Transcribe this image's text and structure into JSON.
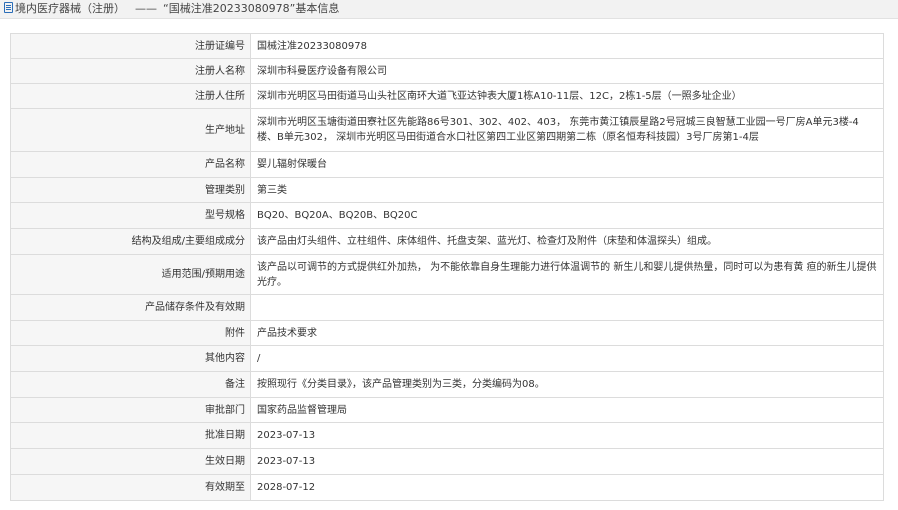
{
  "header": {
    "category": "境内医疗器械（注册）",
    "separator": "——",
    "title": "“国械注准20233080978”基本信息"
  },
  "rows": [
    {
      "label": "注册证编号",
      "value": "国械注准20233080978"
    },
    {
      "label": "注册人名称",
      "value": "深圳市科曼医疗设备有限公司"
    },
    {
      "label": "注册人住所",
      "value": "深圳市光明区马田街道马山头社区南环大道飞亚达钟表大厦1栋A10-11层、12C，2栋1-5层（一照多址企业）"
    },
    {
      "label": "生产地址",
      "value": "深圳市光明区玉塘街道田寮社区先能路86号301、302、402、403， 东莞市黄江镇辰星路2号冠城三良智慧工业园一号厂房A单元3楼-4楼、B单元302， 深圳市光明区马田街道合水口社区第四工业区第四期第二栋（原名恒寿科技园）3号厂房第1-4层"
    },
    {
      "label": "产品名称",
      "value": "婴儿辐射保暖台"
    },
    {
      "label": "管理类别",
      "value": "第三类"
    },
    {
      "label": "型号规格",
      "value": "BQ20、BQ20A、BQ20B、BQ20C"
    },
    {
      "label": "结构及组成/主要组成成分",
      "value": "该产品由灯头组件、立柱组件、床体组件、托盘支架、蓝光灯、检查灯及附件（床垫和体温探头）组成。"
    },
    {
      "label": "适用范围/预期用途",
      "value": "该产品以可调节的方式提供红外加热， 为不能依靠自身生理能力进行体温调节的 新生儿和婴儿提供热量，同时可以为患有黄 疸的新生儿提供光疗。"
    },
    {
      "label": "产品储存条件及有效期",
      "value": ""
    },
    {
      "label": "附件",
      "value": "产品技术要求"
    },
    {
      "label": "其他内容",
      "value": "/"
    },
    {
      "label": "备注",
      "value": "按照现行《分类目录》，该产品管理类别为三类，分类编码为08。"
    },
    {
      "label": "审批部门",
      "value": "国家药品监督管理局"
    },
    {
      "label": "批准日期",
      "value": "2023-07-13"
    },
    {
      "label": "生效日期",
      "value": "2023-07-13"
    },
    {
      "label": "有效期至",
      "value": "2028-07-12"
    }
  ]
}
